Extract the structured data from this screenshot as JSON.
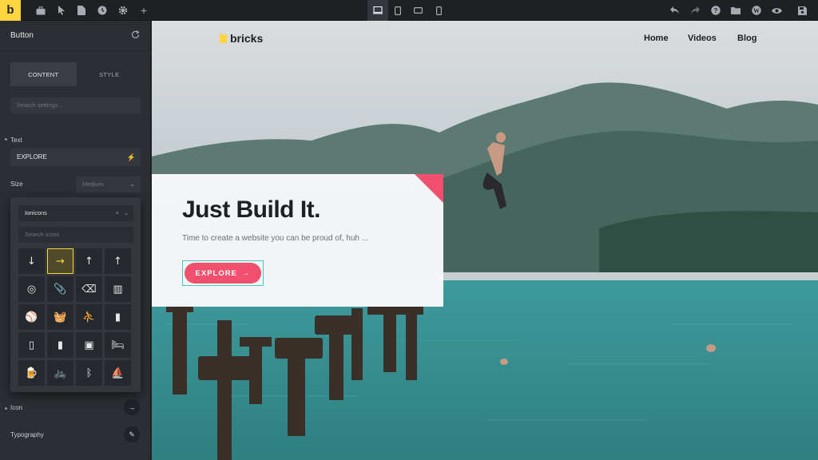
{
  "toolbar": {
    "logo": "b",
    "left_icons": [
      "briefcase-icon",
      "cursor-icon",
      "page-icon",
      "history-icon",
      "gear-icon",
      "plus-icon"
    ],
    "devices": [
      "desktop-icon",
      "tablet-icon",
      "tablet-landscape-icon",
      "mobile-icon"
    ],
    "right_icons": [
      "undo-icon",
      "redo-icon",
      "help-icon",
      "folder-icon",
      "wordpress-icon",
      "eye-icon",
      "save-icon"
    ]
  },
  "sidebar": {
    "title": "Button",
    "tabs": {
      "content": "CONTENT",
      "style": "STYLE"
    },
    "search_placeholder": "Search settings ..",
    "text_label": "Text",
    "text_value": "EXPLORE",
    "size_label": "Size",
    "size_value": "Medium",
    "icon_label": "Icon",
    "typography_label": "Typography"
  },
  "icon_picker": {
    "library": "Ionicons",
    "search_placeholder": "Search icons",
    "icons": [
      {
        "glyph": "↓",
        "name": "arrow-down-icon"
      },
      {
        "glyph": "→",
        "name": "arrow-forward-icon",
        "active": true
      },
      {
        "glyph": "↑",
        "name": "arrow-up-icon"
      },
      {
        "glyph": "↑",
        "name": "arrow-up-thin-icon"
      },
      {
        "glyph": "◎",
        "name": "at-icon"
      },
      {
        "glyph": "📎",
        "name": "attach-icon"
      },
      {
        "glyph": "⌫",
        "name": "backspace-icon"
      },
      {
        "glyph": "▥",
        "name": "barcode-icon"
      },
      {
        "glyph": "⚾",
        "name": "baseball-icon"
      },
      {
        "glyph": "🧺",
        "name": "basket-icon"
      },
      {
        "glyph": "⛹",
        "name": "basketball-icon"
      },
      {
        "glyph": "▮",
        "name": "battery-charging-icon"
      },
      {
        "glyph": "▯",
        "name": "battery-dead-icon"
      },
      {
        "glyph": "▮",
        "name": "battery-full-icon"
      },
      {
        "glyph": "▣",
        "name": "battery-half-icon"
      },
      {
        "glyph": "🛏",
        "name": "bed-icon"
      },
      {
        "glyph": "🍺",
        "name": "beer-icon"
      },
      {
        "glyph": "🚲",
        "name": "bicycle-icon"
      },
      {
        "glyph": "ᛒ",
        "name": "bluetooth-icon"
      },
      {
        "glyph": "⛵",
        "name": "boat-icon"
      }
    ]
  },
  "site": {
    "logo_text": "bricks",
    "nav": [
      "Home",
      "Videos",
      "Blog"
    ],
    "hero_title": "Just Build It.",
    "hero_subtitle": "Time to create a website you can be proud of, huh ...",
    "button_label": "EXPLORE"
  }
}
